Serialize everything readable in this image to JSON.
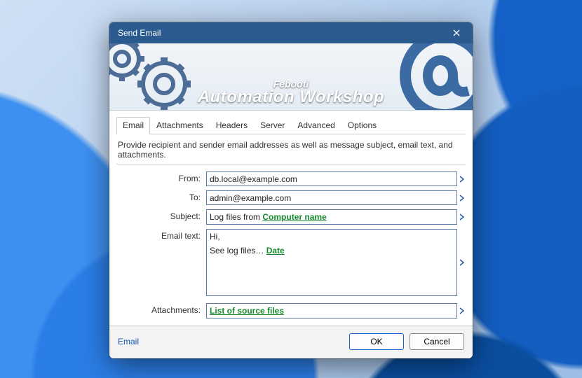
{
  "window": {
    "title": "Send Email"
  },
  "banner": {
    "line1": "Febooti",
    "line2": "Automation Workshop"
  },
  "tabs": [
    {
      "label": "Email",
      "active": true
    },
    {
      "label": "Attachments",
      "active": false
    },
    {
      "label": "Headers",
      "active": false
    },
    {
      "label": "Server",
      "active": false
    },
    {
      "label": "Advanced",
      "active": false
    },
    {
      "label": "Options",
      "active": false
    }
  ],
  "description": "Provide recipient and sender email addresses as well as message subject, email text, and attachments.",
  "form": {
    "from_label": "From:",
    "from_value": "db.local@example.com",
    "to_label": "To:",
    "to_value": "admin@example.com",
    "subject_label": "Subject:",
    "subject_prefix": "Log files from ",
    "subject_token": "Computer name",
    "emailtext_label": "Email text:",
    "emailtext_line1": "Hi,",
    "emailtext_line2_prefix": "See log files… ",
    "emailtext_line2_token": "Date",
    "attachments_label": "Attachments:",
    "attachments_token": "List of source files"
  },
  "footer": {
    "help_link": "Email",
    "ok": "OK",
    "cancel": "Cancel"
  }
}
